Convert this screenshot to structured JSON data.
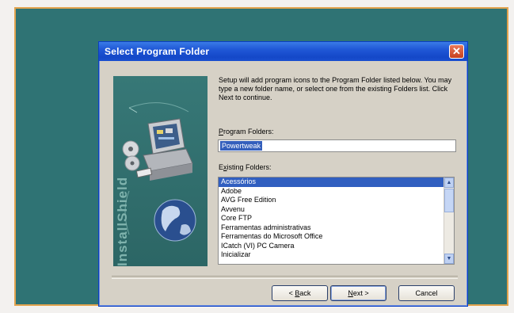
{
  "dialog": {
    "title": "Select Program Folder",
    "close_symbol": "✕",
    "brand_text": "InstallShield",
    "instructions": "Setup will add program icons to the Program Folder listed below. You may type a new folder name, or select one from the existing Folders list.  Click Next to continue.",
    "program_folders": {
      "label_accel": "P",
      "label_rest": "rogram Folders:",
      "value": "Powertweak"
    },
    "existing_folders": {
      "label_pre": "E",
      "label_accel": "x",
      "label_rest": "isting Folders:",
      "items": [
        "Acessórios",
        "Adobe",
        "AVG Free Edition",
        "Avvenu",
        "Core FTP",
        "Ferramentas administrativas",
        "Ferramentas do Microsoft Office",
        "ICatch (VI) PC Camera",
        "Inicializar"
      ],
      "selected_index": 0
    },
    "buttons": {
      "back_pre": "< ",
      "back_accel": "B",
      "back_rest": "ack",
      "next_accel": "N",
      "next_rest": "ext >",
      "cancel": "Cancel"
    },
    "scroll_up_glyph": "▲",
    "scroll_down_glyph": "▼"
  }
}
